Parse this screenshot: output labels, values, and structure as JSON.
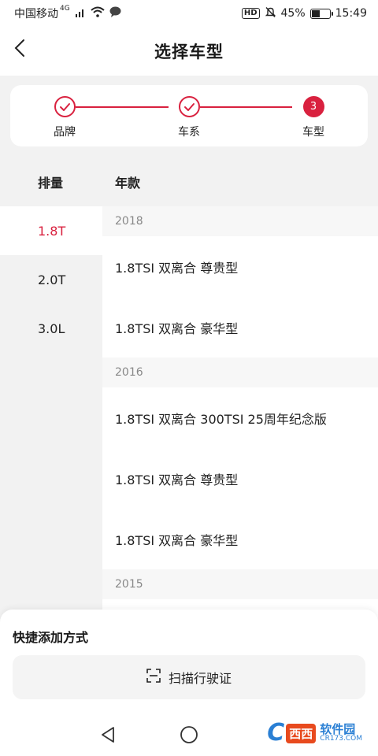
{
  "status_bar": {
    "carrier": "中国移动",
    "network": "4G",
    "hd_badge": "HD",
    "battery_percent": "45%",
    "battery_level": 0.45,
    "time": "15:49",
    "icons": [
      "signal-icon",
      "wifi-icon",
      "chat-bubble-icon",
      "mute-bell-icon",
      "battery-icon"
    ]
  },
  "header": {
    "title": "选择车型",
    "back_icon": "chevron-left-icon"
  },
  "stepper": {
    "steps": [
      {
        "label": "品牌",
        "state": "done"
      },
      {
        "label": "车系",
        "state": "done"
      },
      {
        "label": "车型",
        "state": "current",
        "number": "3"
      }
    ],
    "accent": "#d9213f"
  },
  "sidebar": {
    "header": "排量",
    "items": [
      {
        "label": "1.8T",
        "active": true
      },
      {
        "label": "2.0T",
        "active": false
      },
      {
        "label": "3.0L",
        "active": false
      }
    ]
  },
  "main": {
    "header": "年款",
    "groups": [
      {
        "year": "2018",
        "models": [
          "1.8TSI 双离合 尊贵型",
          "1.8TSI 双离合 豪华型"
        ]
      },
      {
        "year": "2016",
        "models": [
          "1.8TSI 双离合 300TSI 25周年纪念版",
          "1.8TSI 双离合 尊贵型",
          "1.8TSI 双离合 豪华型"
        ]
      },
      {
        "year": "2015",
        "models": []
      }
    ]
  },
  "bottom_sheet": {
    "title": "快捷添加方式",
    "scan_button": "扫描行驶证",
    "scan_icon": "scan-icon"
  },
  "nav_bar": {
    "icons": [
      "back-triangle-icon",
      "home-circle-icon",
      "recents-square-icon"
    ]
  },
  "watermark": {
    "logo_letter": "C",
    "badge": "西西",
    "name": "软件园",
    "domain": "CR173.COM"
  }
}
